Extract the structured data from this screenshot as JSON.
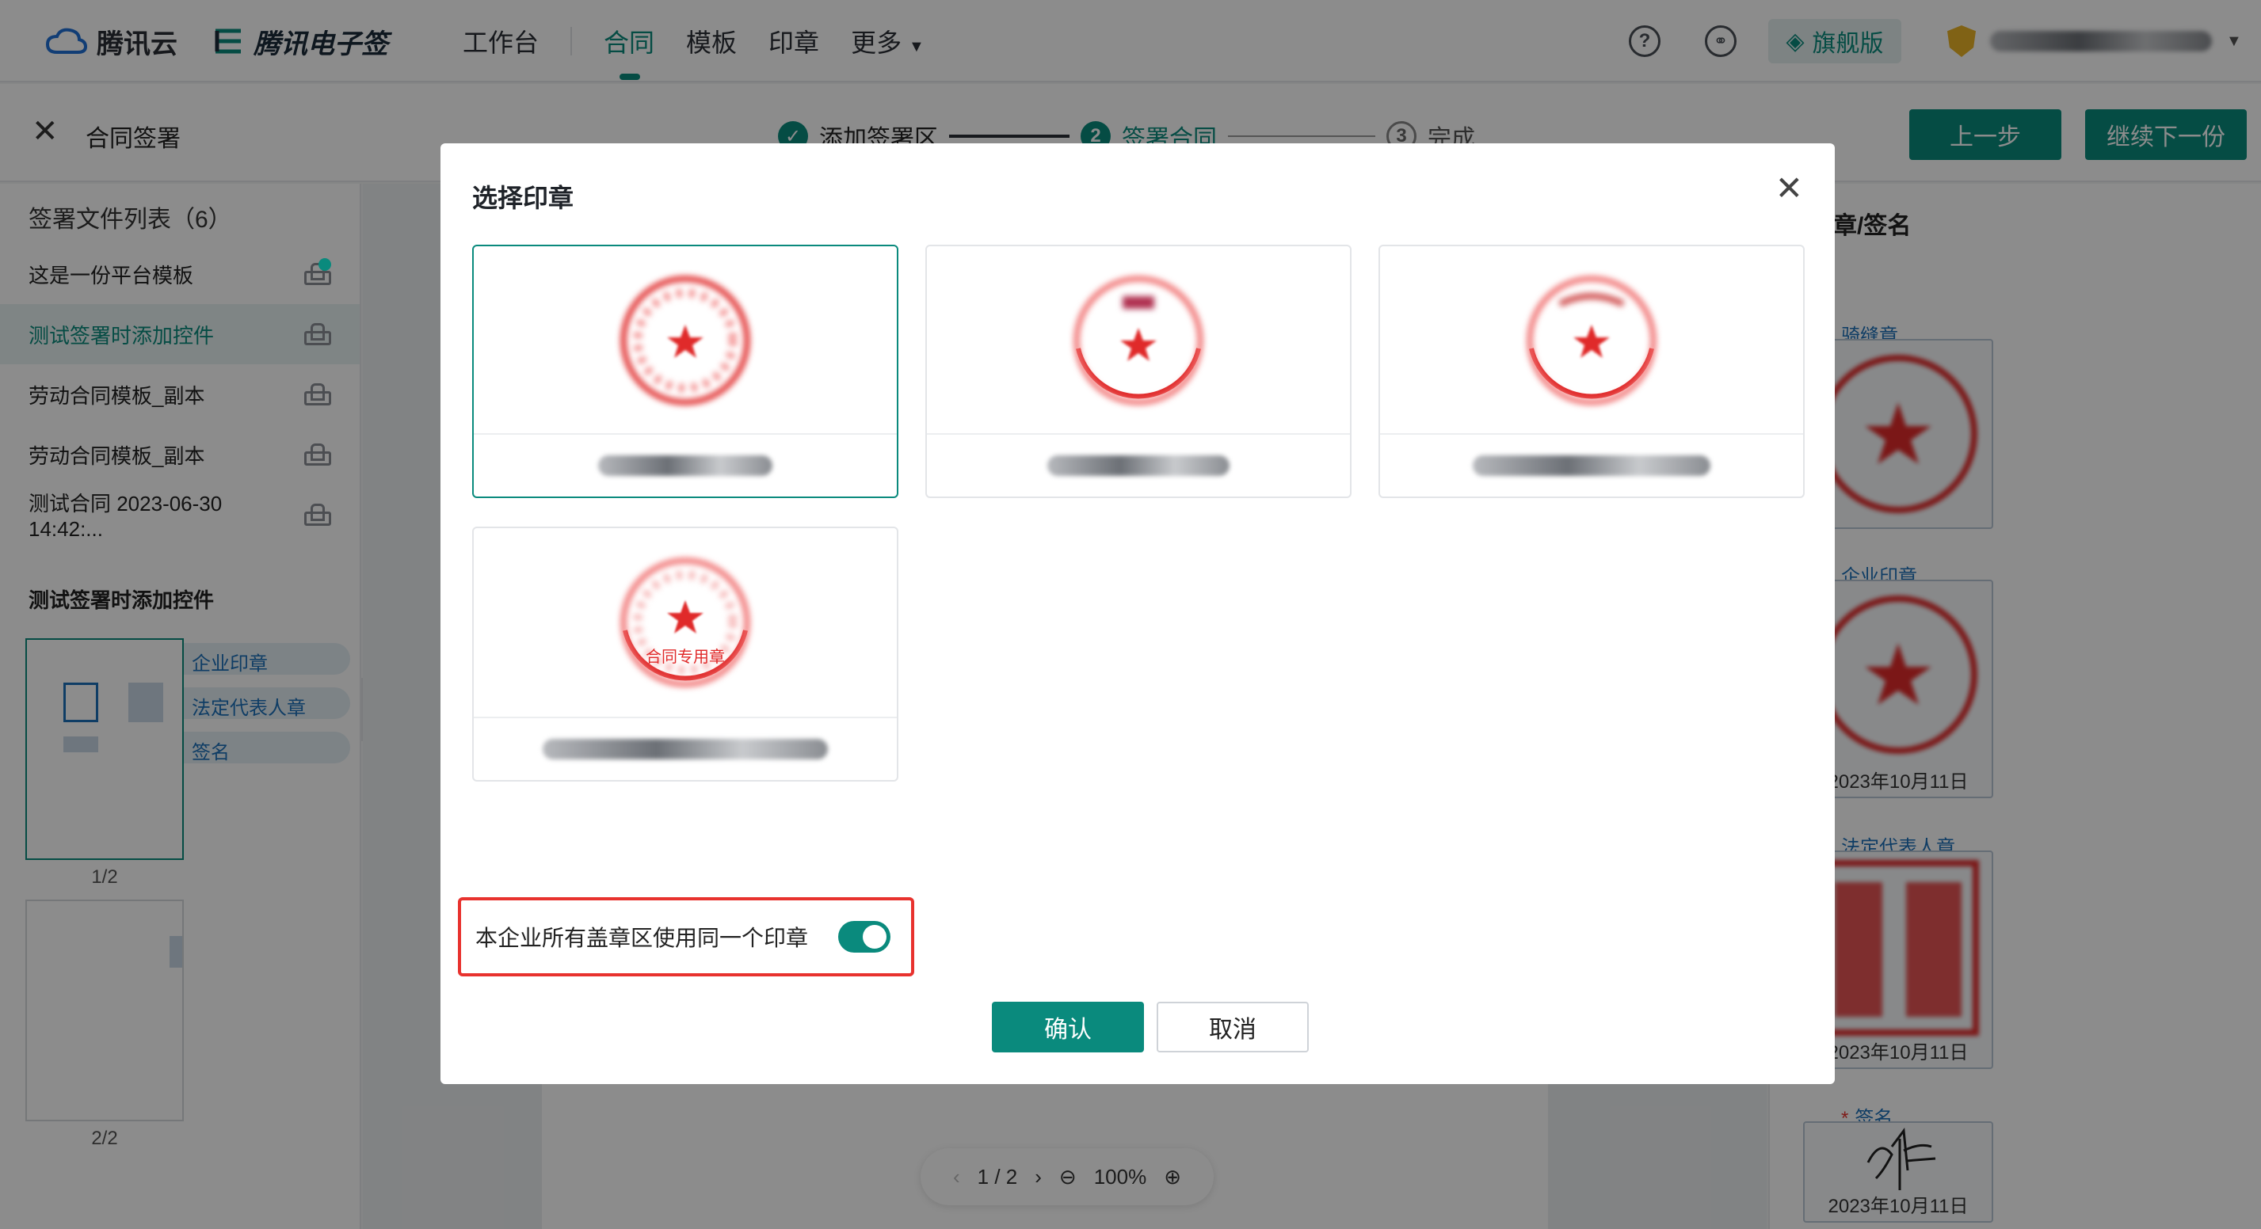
{
  "topnav": {
    "brand_cloud": "腾讯云",
    "brand_esign": "腾讯电子签",
    "links": [
      "工作台",
      "合同",
      "模板",
      "印章",
      "更多"
    ],
    "active_link": "合同",
    "help_icon": "help-circle-icon",
    "link_icon": "link-circle-icon",
    "flagship_label": "旗舰版",
    "accent": "#0a8a7d"
  },
  "subheader": {
    "title": "合同签署",
    "steps": [
      {
        "num": "✓",
        "label": "添加签署区"
      },
      {
        "num": "2",
        "label": "签署合同"
      },
      {
        "num": "3",
        "label": "完成"
      }
    ],
    "prev_button": "上一步",
    "next_button": "继续下一份"
  },
  "leftpanel": {
    "title": "签署文件列表（6）",
    "files": [
      "这是一份平台模板",
      "测试签署时添加控件",
      "劳动合同模板_副本",
      "劳动合同模板_副本",
      "测试合同 2023-06-30 14:42:..."
    ],
    "current_file": "测试签署时添加控件",
    "chips": [
      "企业印章",
      "法定代表人章",
      "签名"
    ],
    "pages": [
      "1/2",
      "2/2"
    ]
  },
  "pager": {
    "current": "1 / 2",
    "zoom": "100%"
  },
  "rightpanel": {
    "title": "择印章/签名",
    "labels": [
      "骑缝章",
      "企业印章",
      "法定代表人章",
      "签名"
    ],
    "required_mark": "*",
    "dates": [
      "2023年10月11日",
      "2023年10月11日",
      "2023年10月11日"
    ]
  },
  "modal": {
    "title": "选择印章",
    "seal_special_text": "合同专用章",
    "toggle_label": "本企业所有盖章区使用同一个印章",
    "toggle_on": true,
    "confirm": "确认",
    "cancel": "取消",
    "danger_color": "#e8322e",
    "seal_color": "#e02a2a"
  }
}
